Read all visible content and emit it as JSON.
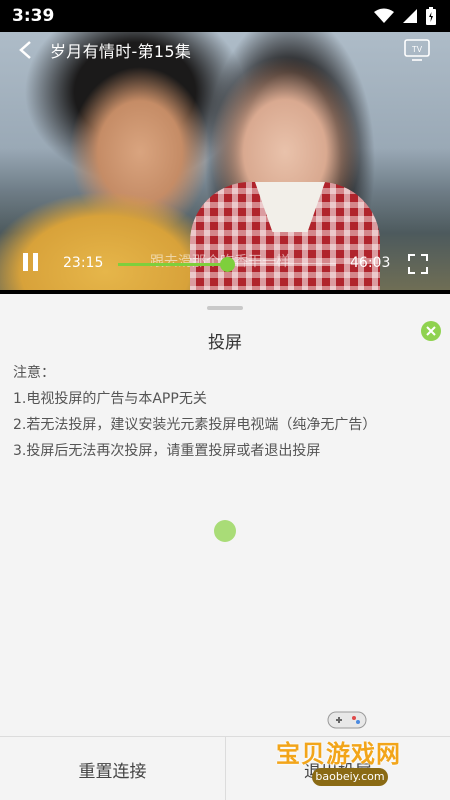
{
  "status_bar": {
    "time": "3:39"
  },
  "player": {
    "title": "岁月有情时-第15集",
    "current_time": "23:15",
    "total_time": "46:03",
    "subtitle": "跟去滑那个吃香干一样",
    "progress_fraction": 0.5,
    "accent_color": "#7ecf3c"
  },
  "sheet": {
    "title": "投屏",
    "notes_heading": "注意：",
    "notes": [
      "1.电视投屏的广告与本APP无关",
      "2.若无法投屏，建议安装光元素投屏电视端（纯净无广告）",
      "3.投屏后无法再次投屏，请重置投屏或者退出投屏"
    ],
    "buttons": {
      "reset": "重置连接",
      "exit": "退出投屏"
    }
  },
  "watermark": {
    "name": "宝贝游戏网",
    "url": "baobeiy.com"
  },
  "icons": [
    "back-icon",
    "tv-cast-icon",
    "pause-icon",
    "fullscreen-icon",
    "close-icon",
    "wifi-icon",
    "signal-icon",
    "battery-icon"
  ]
}
